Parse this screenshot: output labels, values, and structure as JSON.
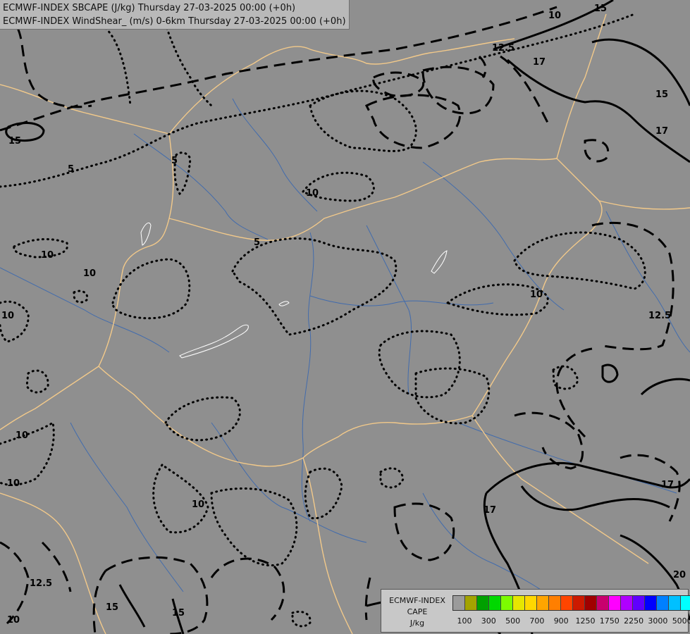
{
  "header": {
    "line1": "ECMWF-INDEX SBCAPE (J/kg) Thursday 27-03-2025 00:00 (+0h)",
    "line2": "ECMWF-INDEX WindShear_ (m/s) 0-6km Thursday 27-03-2025 00:00 (+0h)"
  },
  "legend": {
    "title_lines": [
      "ECMWF-INDEX",
      "CAPE",
      "J/kg"
    ],
    "colors": [
      "#9b9b9b",
      "#a3a300",
      "#00a000",
      "#00d800",
      "#7cfc00",
      "#e6e600",
      "#ffd700",
      "#ffa500",
      "#ff7f00",
      "#ff4500",
      "#cc1a00",
      "#a00000",
      "#c8006e",
      "#ff00ff",
      "#b000ff",
      "#6000ff",
      "#0000ff",
      "#0080ff",
      "#00c0ff",
      "#00ffff",
      "#a0ffff",
      "#ffffff"
    ],
    "ticks": [
      "100",
      "300",
      "500",
      "700",
      "900",
      "1250",
      "1750",
      "2250",
      "3000",
      "5000"
    ]
  },
  "contour_labels": [
    "15",
    "10",
    "12.5",
    "17",
    "15",
    "17",
    "5",
    "5",
    "10",
    "10",
    "10",
    "5",
    "10",
    "12.5",
    "10",
    "10",
    "10",
    "17",
    "17",
    "20",
    "12.5",
    "15",
    "15",
    "10",
    "10",
    "15"
  ],
  "colors": {
    "background": "#8f8f8f",
    "borders": "#f2c98a",
    "rivers": "#3a68b0",
    "contours": "#000000",
    "lakes": "#ffffff"
  }
}
